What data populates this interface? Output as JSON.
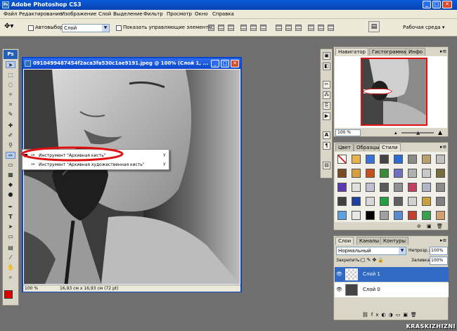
{
  "window": {
    "title": "Adobe Photoshop CS3",
    "app_icon": "Ps"
  },
  "menu": [
    "Файл",
    "Редактирование",
    "Изображение",
    "Слой",
    "Выделение",
    "Фильтр",
    "Просмотр",
    "Окно",
    "Справка"
  ],
  "options": {
    "autoselect_label": "Автовыбор:",
    "autoselect_value": "Слой",
    "show_controls_label": "Показать управляющие элементы",
    "workspace_label": "Рабочая среда ▾"
  },
  "toolbox": {
    "header": "Ps"
  },
  "document": {
    "title": "0910499487454f2aca3fa530c1ae9191.jpeg @ 100% (Слой 1, ...",
    "zoom": "100 %",
    "size_info": "16,93 см x 16,93 см (72 pt)"
  },
  "popup": {
    "items": [
      {
        "label": "Инструмент \"Архивная кисть\"",
        "shortcut": "Y"
      },
      {
        "label": "Инструмент \"Архивная художественная кисть\"",
        "shortcut": "Y"
      }
    ]
  },
  "navigator": {
    "tabs": [
      "Навигатор",
      "Гистограмма",
      "Инфо"
    ],
    "zoom": "100 %"
  },
  "styles": {
    "tabs": [
      "Цвет",
      "Образцы",
      "Стили"
    ],
    "colors": [
      "#ffffff",
      "#e8b24a",
      "#3a73d6",
      "#444444",
      "#2c6bd2",
      "#8a8a8a",
      "#b8a070",
      "#c0c0c0",
      "#7a4a20",
      "#d4a040",
      "#c85020",
      "#3a8a3a",
      "#7070c0",
      "#b0b0b0",
      "#c8c8c8",
      "#7a6a40",
      "#5a3ab0",
      "#e0e0e0",
      "#c0c0d0",
      "#5a5a5a",
      "#909090",
      "#c04060",
      "#b0b8c8",
      "#8a8a8a",
      "#404040",
      "#2040a0",
      "#d8d8d8",
      "#20a040",
      "#606060",
      "#d0d0d0",
      "#c8a040",
      "#808080",
      "#60a0e0",
      "#e8e8e8",
      "#000000",
      "#a0a0a0",
      "#5a8ad0",
      "#c04030",
      "#3aa050",
      "#d0a070"
    ]
  },
  "layers": {
    "tabs": [
      "Слои",
      "Каналы",
      "Контуры"
    ],
    "blend_mode": "Нормальный",
    "opacity_label": "Непрозр.:",
    "opacity_value": "100%",
    "lock_label": "Закрепить:",
    "fill_label": "Заливка:",
    "fill_value": "100%",
    "items": [
      {
        "name": "Слой 1"
      },
      {
        "name": "Слой 0"
      }
    ]
  },
  "watermark": "KRASKIZHIZNI",
  "colors": {
    "title_blue": "#0a47c8",
    "selection_blue": "#316ac5",
    "foreground": "#e00000",
    "annotation_red": "#e01010"
  }
}
